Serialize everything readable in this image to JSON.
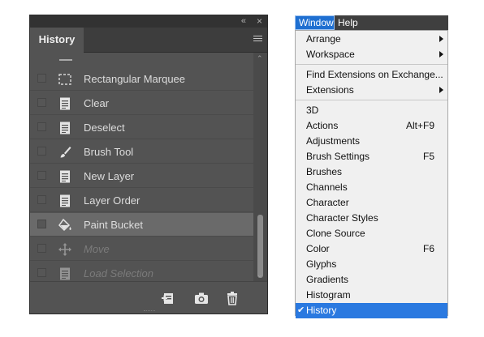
{
  "history_panel": {
    "collapse_glyph": "«",
    "close_glyph": "×",
    "tab_label": "History",
    "items": [
      {
        "label": "Rectangular Marquee",
        "icon": "marquee-icon",
        "state": "normal"
      },
      {
        "label": "Clear",
        "icon": "document-icon",
        "state": "normal"
      },
      {
        "label": "Deselect",
        "icon": "document-icon",
        "state": "normal"
      },
      {
        "label": "Brush Tool",
        "icon": "brush-icon",
        "state": "normal"
      },
      {
        "label": "New Layer",
        "icon": "document-icon",
        "state": "normal"
      },
      {
        "label": "Layer Order",
        "icon": "document-icon",
        "state": "normal"
      },
      {
        "label": "Paint Bucket",
        "icon": "paint-bucket-icon",
        "state": "selected"
      },
      {
        "label": "Move",
        "icon": "move-icon",
        "state": "dimmed"
      },
      {
        "label": "Load Selection",
        "icon": "document-icon",
        "state": "dimmed"
      }
    ],
    "footer_icons": [
      "new-document-from-state-icon",
      "camera-icon",
      "trash-icon"
    ],
    "colors": {
      "panel": "#535353",
      "selected_row": "#6a6a6a",
      "text": "#dddddd",
      "dim_text": "#7b7b7b"
    }
  },
  "menubar": {
    "items": [
      {
        "label": "Window",
        "active": true
      },
      {
        "label": "Help",
        "active": false
      }
    ]
  },
  "window_menu": {
    "groups": [
      [
        {
          "label": "Arrange",
          "submenu": true
        },
        {
          "label": "Workspace",
          "submenu": true
        }
      ],
      [
        {
          "label": "Find Extensions on Exchange..."
        },
        {
          "label": "Extensions",
          "submenu": true
        }
      ],
      [
        {
          "label": "3D"
        },
        {
          "label": "Actions",
          "shortcut": "Alt+F9"
        },
        {
          "label": "Adjustments"
        },
        {
          "label": "Brush Settings",
          "shortcut": "F5"
        },
        {
          "label": "Brushes"
        },
        {
          "label": "Channels"
        },
        {
          "label": "Character"
        },
        {
          "label": "Character Styles"
        },
        {
          "label": "Clone Source"
        },
        {
          "label": "Color",
          "shortcut": "F6"
        },
        {
          "label": "Glyphs"
        },
        {
          "label": "Gradients"
        },
        {
          "label": "Histogram"
        },
        {
          "label": "History",
          "checked": true,
          "check_glyph": "✔"
        }
      ]
    ],
    "colors": {
      "background": "#f0f0f0",
      "highlight": "#2a79e0",
      "menubar": "#3f3f3f"
    }
  }
}
